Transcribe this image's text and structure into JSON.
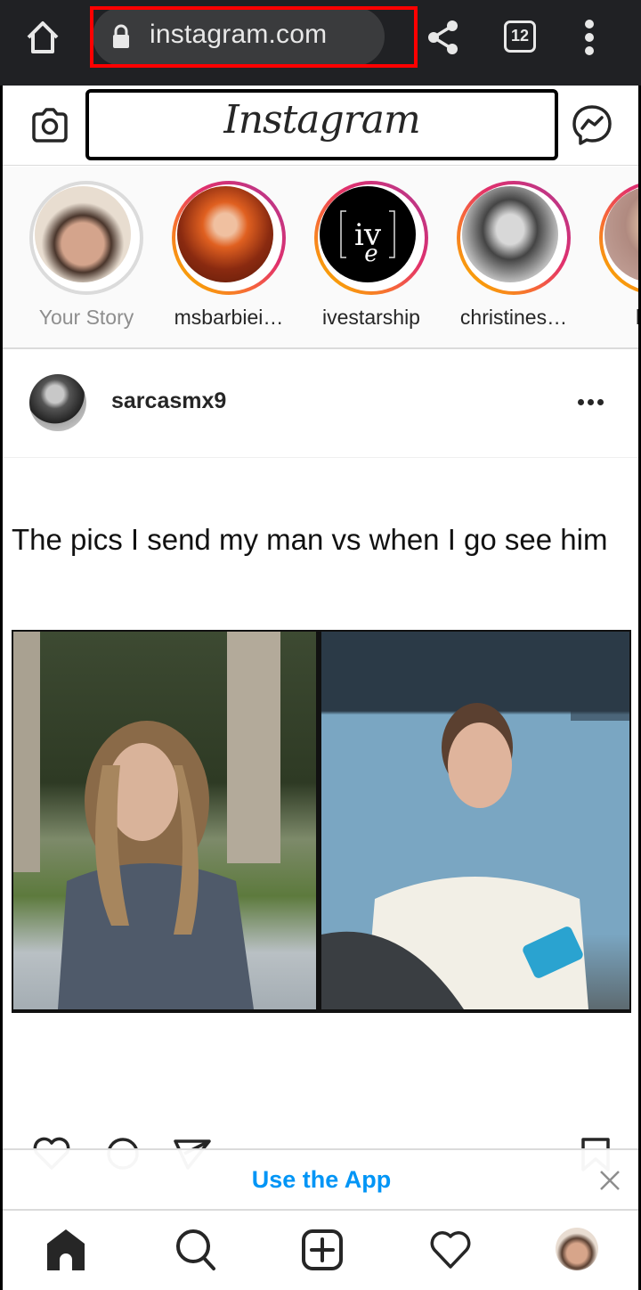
{
  "browser": {
    "url": "instagram.com",
    "tab_count": "12",
    "icons": {
      "home": "home-icon",
      "lock": "lock-icon",
      "share": "share-icon",
      "tabs": "tab-switcher-icon",
      "menu": "more-vertical-icon"
    },
    "highlight_color": "#ff0000"
  },
  "header": {
    "logo": "Instagram",
    "icons": {
      "camera": "camera-icon",
      "messenger": "messenger-icon"
    }
  },
  "stories": [
    {
      "label": "Your Story",
      "own": true
    },
    {
      "label": "msbarbiei…",
      "own": false
    },
    {
      "label": "ivestarship",
      "own": false
    },
    {
      "label": "christines…",
      "own": false
    },
    {
      "label": "kylie",
      "own": false
    }
  ],
  "post": {
    "username": "sarcasmx9",
    "caption": "The pics I send my man vs when I go see him",
    "actions": [
      "like-icon",
      "comment-icon",
      "share-icon",
      "save-icon"
    ]
  },
  "banner": {
    "label": "Use the App",
    "color": "#0095f6"
  },
  "bottom_nav": [
    "home-icon",
    "search-icon",
    "new-post-icon",
    "activity-icon",
    "profile-avatar"
  ]
}
